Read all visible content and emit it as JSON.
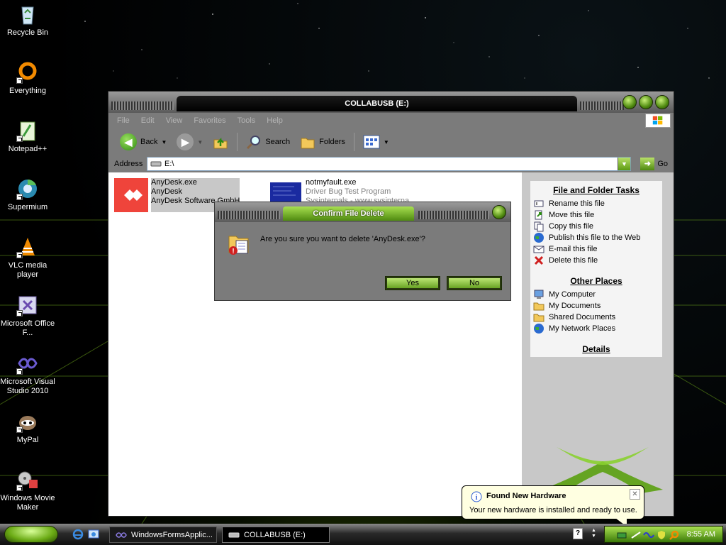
{
  "desktop": {
    "icons": [
      {
        "label": "Recycle Bin",
        "icon": "recycle-bin-icon"
      },
      {
        "label": "Everything",
        "icon": "everything-icon"
      },
      {
        "label": "Notepad++",
        "icon": "notepadpp-icon"
      },
      {
        "label": "Supermium",
        "icon": "supermium-icon"
      },
      {
        "label": "VLC media player",
        "icon": "vlc-icon"
      },
      {
        "label": "Microsoft Office F...",
        "icon": "office-icon"
      },
      {
        "label": "Microsoft Visual Studio 2010",
        "icon": "visual-studio-icon"
      },
      {
        "label": "MyPal",
        "icon": "mypal-icon"
      },
      {
        "label": "Windows Movie Maker",
        "icon": "movie-maker-icon"
      }
    ]
  },
  "explorer": {
    "title": "COLLABUSB (E:)",
    "menu": [
      "File",
      "Edit",
      "View",
      "Favorites",
      "Tools",
      "Help"
    ],
    "toolbar": {
      "back": "Back",
      "search": "Search",
      "folders": "Folders"
    },
    "address": {
      "label": "Address",
      "value": "E:\\",
      "go": "Go"
    },
    "files": [
      {
        "name": "AnyDesk.exe",
        "line2": "AnyDesk",
        "line3": "AnyDesk Software GmbH",
        "selected": true
      },
      {
        "name": "notmyfault.exe",
        "line2": "Driver Bug Test Program",
        "line3": "Sysinternals - www.sysinterna..."
      }
    ],
    "tasks": {
      "file_folder_tasks": {
        "heading": "File and Folder Tasks",
        "items": [
          "Rename this file",
          "Move this file",
          "Copy this file",
          "Publish this file to the Web",
          "E-mail this file",
          "Delete this file"
        ]
      },
      "other_places": {
        "heading": "Other Places",
        "items": [
          "My Computer",
          "My Documents",
          "Shared Documents",
          "My Network Places"
        ]
      },
      "details": {
        "heading": "Details"
      }
    }
  },
  "dialog": {
    "title": "Confirm File Delete",
    "message": "Are you sure you want to delete 'AnyDesk.exe'?",
    "yes": "Yes",
    "no": "No"
  },
  "balloon": {
    "title": "Found New Hardware",
    "body": "Your new hardware is installed and ready to use."
  },
  "taskbar": {
    "buttons": [
      "WindowsFormsApplic...",
      "COLLABUSB (E:)"
    ],
    "clock": "8:55 AM"
  },
  "colors": {
    "accent_green": "#6aaa14",
    "window_gray": "#7b7b7b",
    "tasks_panel": "#c8c8c8"
  }
}
